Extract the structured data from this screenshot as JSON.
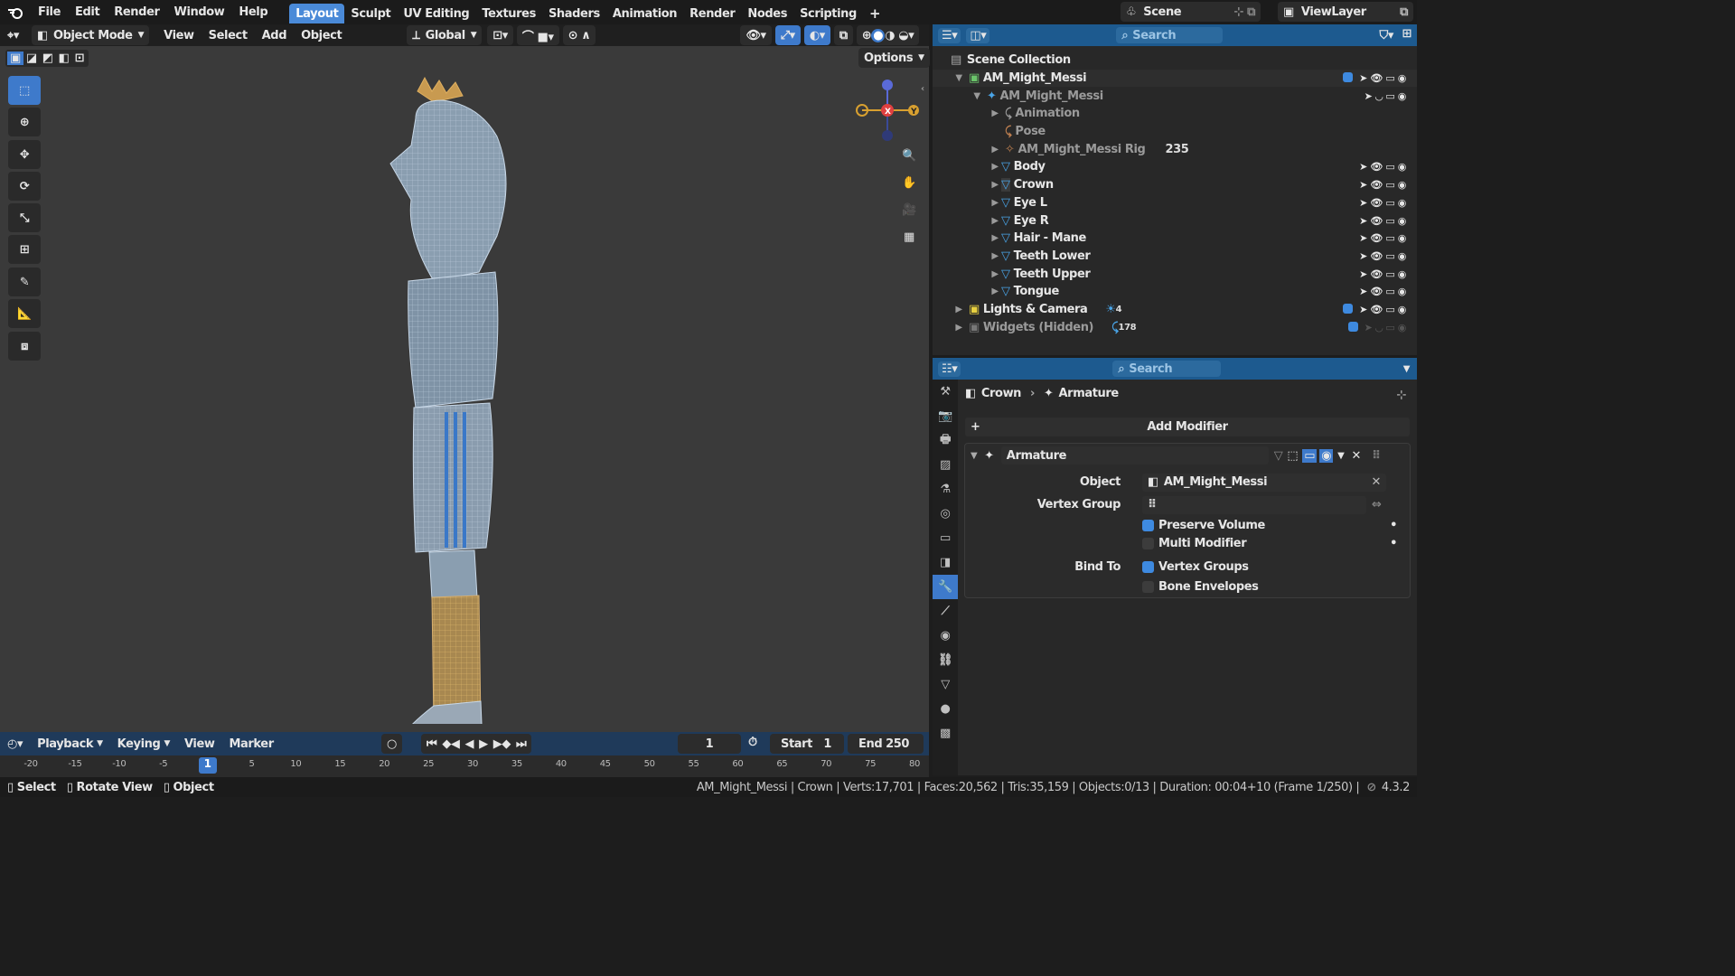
{
  "menu": {
    "file": "File",
    "edit": "Edit",
    "render": "Render",
    "window": "Window",
    "help": "Help"
  },
  "workspaces": [
    "Layout",
    "Sculpt",
    "UV Editing",
    "Textures",
    "Shaders",
    "Animation",
    "Render",
    "Nodes",
    "Scripting"
  ],
  "scene": {
    "name": "Scene",
    "view_layer": "ViewLayer"
  },
  "viewport_header": {
    "mode": "Object Mode",
    "view": "View",
    "select": "Select",
    "add": "Add",
    "object": "Object",
    "orientation": "Global",
    "options": "Options"
  },
  "gizmo": {
    "x": "X",
    "y": "Y"
  },
  "outliner": {
    "search_placeholder": "Search",
    "scene_collection": "Scene Collection",
    "items": [
      {
        "label": "AM_Might_Messi",
        "count": ""
      },
      {
        "label": "AM_Might_Messi",
        "count": ""
      },
      {
        "label": "Animation",
        "count": ""
      },
      {
        "label": "Pose",
        "count": ""
      },
      {
        "label": "AM_Might_Messi Rig",
        "count": "235"
      },
      {
        "label": "Body",
        "count": ""
      },
      {
        "label": "Crown",
        "count": ""
      },
      {
        "label": "Eye L",
        "count": ""
      },
      {
        "label": "Eye R",
        "count": ""
      },
      {
        "label": "Hair - Mane",
        "count": ""
      },
      {
        "label": "Teeth Lower",
        "count": ""
      },
      {
        "label": "Teeth Upper",
        "count": ""
      },
      {
        "label": "Tongue",
        "count": ""
      },
      {
        "label": "Lights & Camera",
        "count": "4"
      },
      {
        "label": "Widgets (Hidden)",
        "count": "178"
      }
    ]
  },
  "properties": {
    "search_placeholder": "Search",
    "breadcrumb_object": "Crown",
    "breadcrumb_modifier": "Armature",
    "add_modifier": "Add Modifier",
    "modifier_name": "Armature",
    "object_label": "Object",
    "object_value": "AM_Might_Messi",
    "vertex_group_label": "Vertex Group",
    "vertex_group_value": "",
    "preserve_volume": "Preserve Volume",
    "multi_modifier": "Multi Modifier",
    "bind_to": "Bind To",
    "vertex_groups": "Vertex Groups",
    "bone_envelopes": "Bone Envelopes"
  },
  "timeline": {
    "playback": "Playback",
    "keying": "Keying",
    "view": "View",
    "marker": "Marker",
    "current_frame": "1",
    "start_label": "Start",
    "start": "1",
    "end_label": "End",
    "end": "250",
    "ruler": [
      "-20",
      "-15",
      "-10",
      "-5",
      "1",
      "5",
      "10",
      "15",
      "20",
      "25",
      "30",
      "35",
      "40",
      "45",
      "50",
      "55",
      "60",
      "65",
      "70",
      "75",
      "80"
    ]
  },
  "status": {
    "select": "Select",
    "rotate": "Rotate View",
    "object": "Object",
    "info": "AM_Might_Messi | Crown | Verts:17,701 | Faces:20,562 | Tris:35,159 | Objects:0/13 | Duration: 00:04+10 (Frame 1/250) |",
    "version": "4.3.2"
  },
  "colors": {
    "accent": "#4a8ad8",
    "header_blue": "#1d5a8f",
    "wire": "#c8d8e8",
    "gold": "#c8a060"
  }
}
